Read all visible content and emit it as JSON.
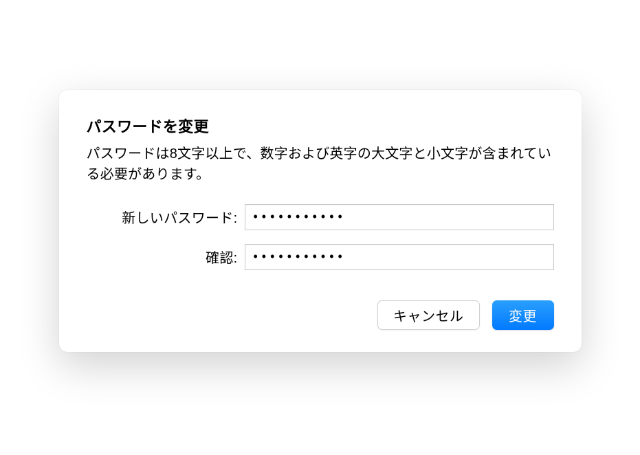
{
  "dialog": {
    "title": "パスワードを変更",
    "description": "パスワードは8文字以上で、数字および英字の大文字と小文字が含まれている必要があります。",
    "fields": {
      "new_password": {
        "label": "新しいパスワード:",
        "value": "•••••••••••"
      },
      "confirm_password": {
        "label": "確認:",
        "value": "•••••••••••"
      }
    },
    "buttons": {
      "cancel": "キャンセル",
      "submit": "変更"
    }
  }
}
